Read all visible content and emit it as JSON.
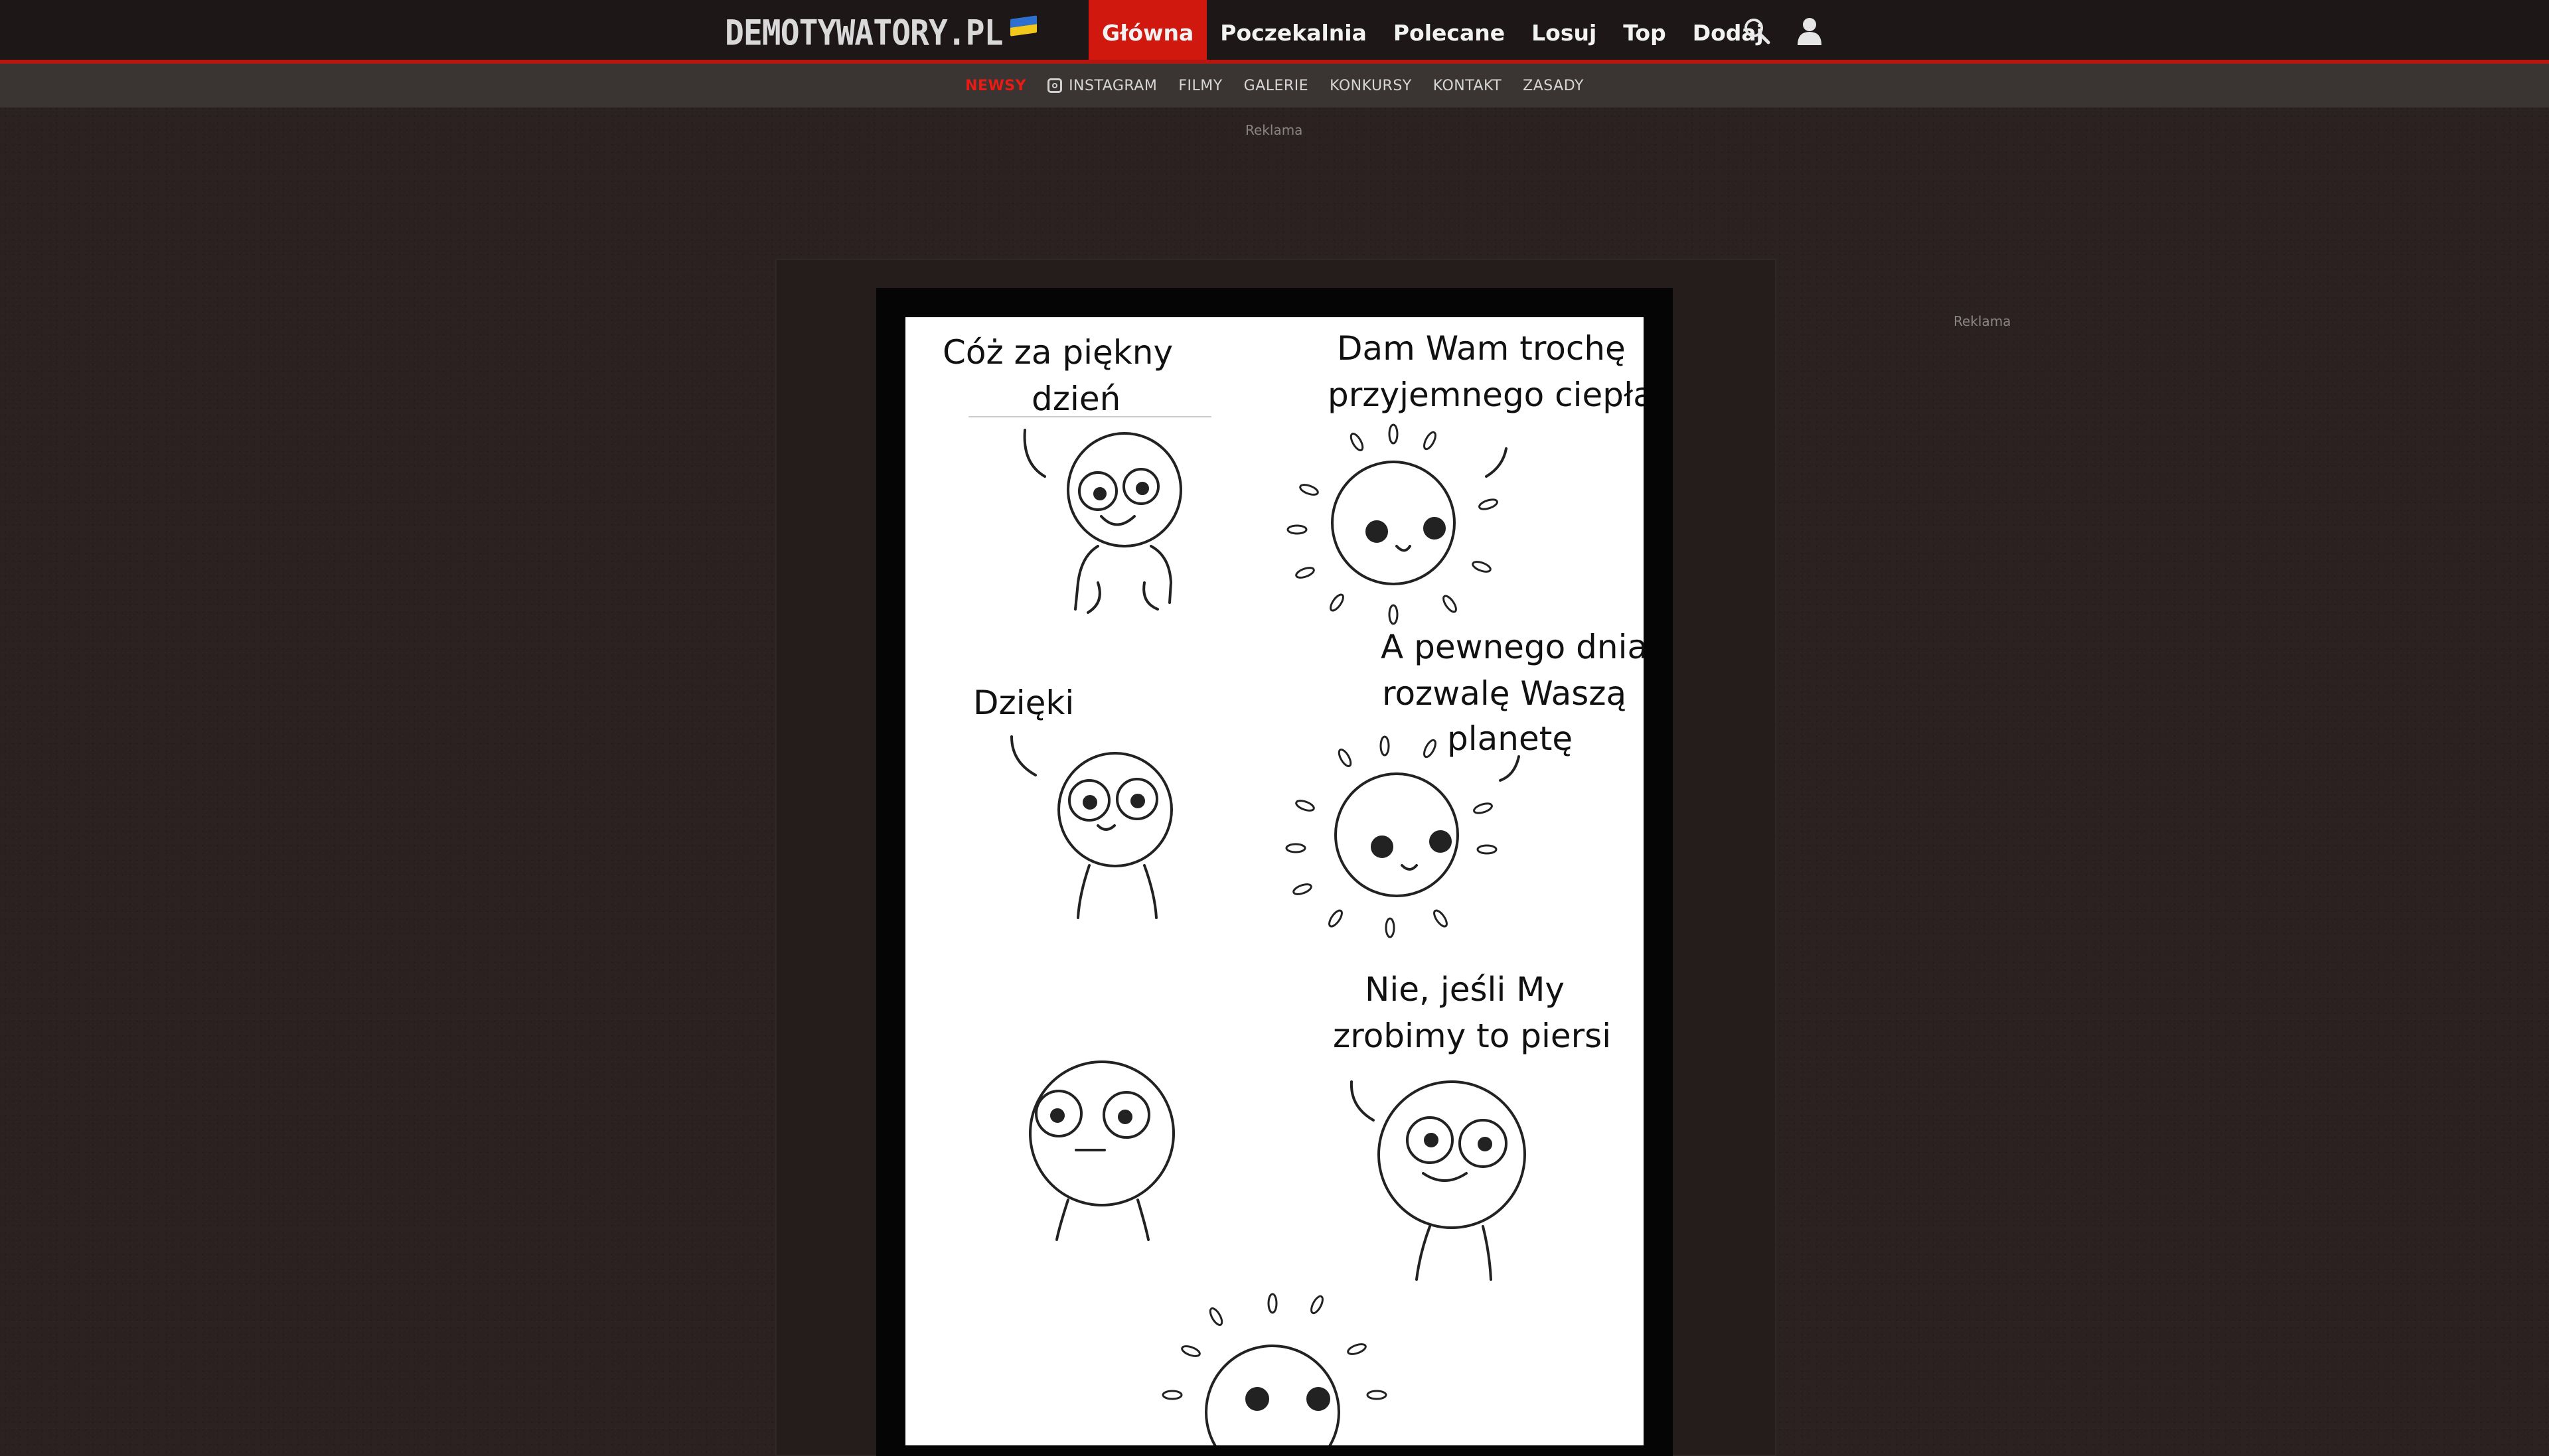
{
  "header": {
    "logo": "DEMOTYWATORY.PL",
    "nav": [
      "Główna",
      "Poczekalnia",
      "Polecane",
      "Losuj",
      "Top",
      "Dodaj"
    ],
    "active": "Główna",
    "icons": [
      "search-icon",
      "user-icon"
    ],
    "accent": "#d0180f"
  },
  "subnav": {
    "items": [
      "NEWSY",
      "INSTAGRAM",
      "FILMY",
      "GALERIE",
      "KONKURSY",
      "KONTAKT",
      "ZASADY"
    ]
  },
  "ads": {
    "top_label": "Reklama",
    "side_label": "Reklama"
  },
  "comic": {
    "panel1_line1": "Cóż za piękny",
    "panel1_line2": "dzień",
    "panel2_line1": "Dam Wam trochę",
    "panel2_line2": "przyjemnego ciepła",
    "panel3_text": "Dzięki",
    "panel4_line1": "A pewnego dnia",
    "panel4_line2": "rozwalę Waszą",
    "panel4_line3": "planetę",
    "panel6_line1": "Nie, jeśli My",
    "panel6_line2": "zrobimy to piersi"
  }
}
